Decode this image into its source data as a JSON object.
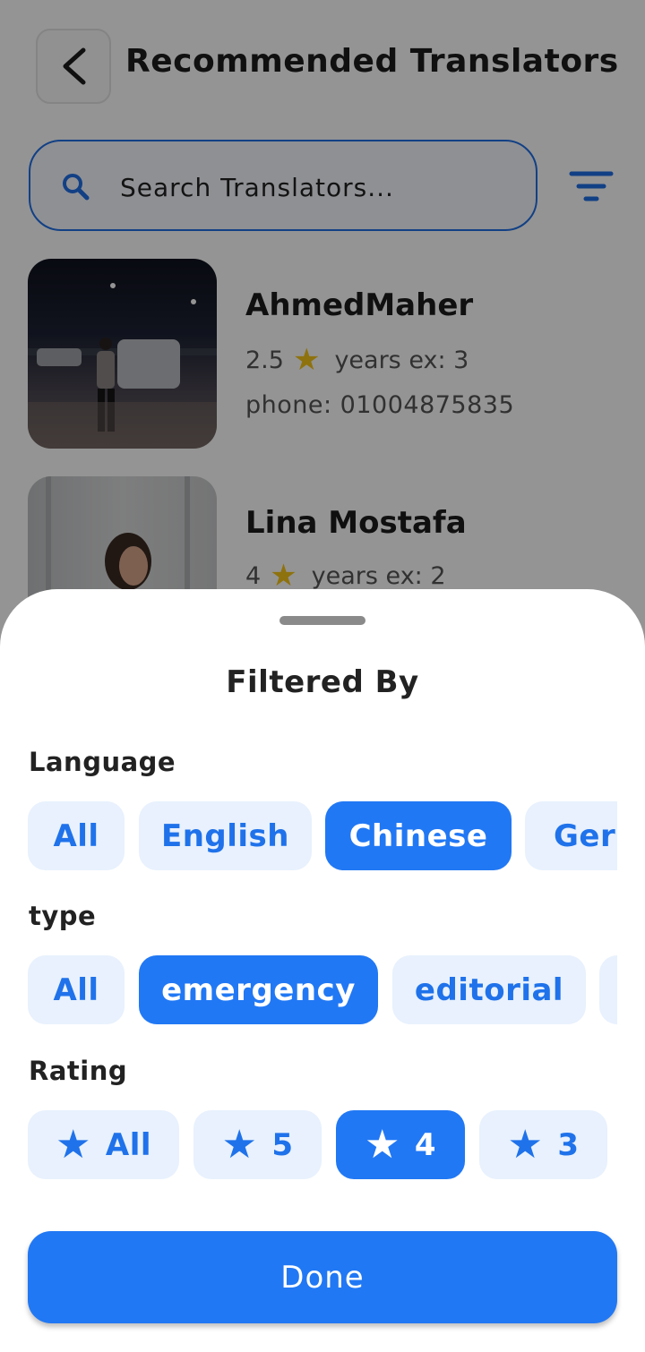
{
  "header": {
    "title": "Recommended Translators"
  },
  "search": {
    "placeholder": "Search Translators..."
  },
  "translators": [
    {
      "name": "AhmedMaher",
      "rating": "2.5",
      "experience": "years ex: 3",
      "phone": "phone: 01004875835"
    },
    {
      "name": "Lina Mostafa",
      "rating": "4",
      "experience": "years ex: 2"
    }
  ],
  "filter_sheet": {
    "title": "Filtered By",
    "language": {
      "label": "Language",
      "options": [
        "All",
        "English",
        "Chinese",
        "Germ"
      ],
      "selected": "Chinese"
    },
    "type": {
      "label": "type",
      "options": [
        "All",
        "emergency",
        "editorial"
      ],
      "selected": "emergency"
    },
    "rating": {
      "label": "Rating",
      "options": [
        "All",
        "5",
        "4",
        "3"
      ],
      "selected": "4"
    },
    "done_label": "Done"
  },
  "colors": {
    "accent": "#2178f4",
    "chip_bg": "#e8f1fd",
    "star": "#f5c518"
  }
}
